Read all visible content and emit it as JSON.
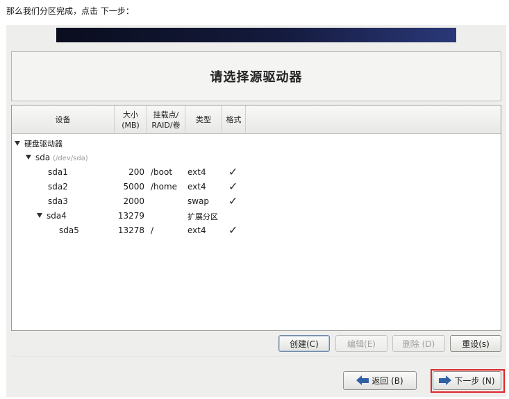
{
  "caption": "那么我们分区完成，点击 下一步：",
  "window": {
    "title": "请选择源驱动器"
  },
  "table": {
    "headers": {
      "device": "设备",
      "size_line1": "大小",
      "size_line2": "(MB)",
      "mount_line1": "挂载点/",
      "mount_line2": "RAID/卷",
      "type": "类型",
      "format": "格式"
    },
    "rows": [
      {
        "device": "硬盘驱动器",
        "size": "",
        "mount": "",
        "type": "",
        "format": false
      },
      {
        "device": "sda",
        "sub": "(/dev/sda)",
        "size": "",
        "mount": "",
        "type": "",
        "format": false
      },
      {
        "device": "sda1",
        "size": "200",
        "mount": "/boot",
        "type": "ext4",
        "format": true
      },
      {
        "device": "sda2",
        "size": "5000",
        "mount": "/home",
        "type": "ext4",
        "format": true
      },
      {
        "device": "sda3",
        "size": "2000",
        "mount": "",
        "type": "swap",
        "format": true
      },
      {
        "device": "sda4",
        "size": "13279",
        "mount": "",
        "type": "扩展分区",
        "format": false
      },
      {
        "device": "sda5",
        "size": "13278",
        "mount": "/",
        "type": "ext4",
        "format": true
      }
    ],
    "check_glyph": "✓"
  },
  "actions": {
    "create": "创建(C)",
    "edit": "编辑(E)",
    "delete": "删除 (D)",
    "reset": "重设(s)"
  },
  "nav": {
    "back": "返回 (B)",
    "next": "下一步 (N)"
  },
  "colors": {
    "highlight": "#e0262b",
    "arrow": "#2f5fa4"
  },
  "icons": {
    "back": "arrow-left-icon",
    "next": "arrow-right-icon",
    "expand": "triangle-down-icon",
    "check": "checkmark-icon"
  }
}
